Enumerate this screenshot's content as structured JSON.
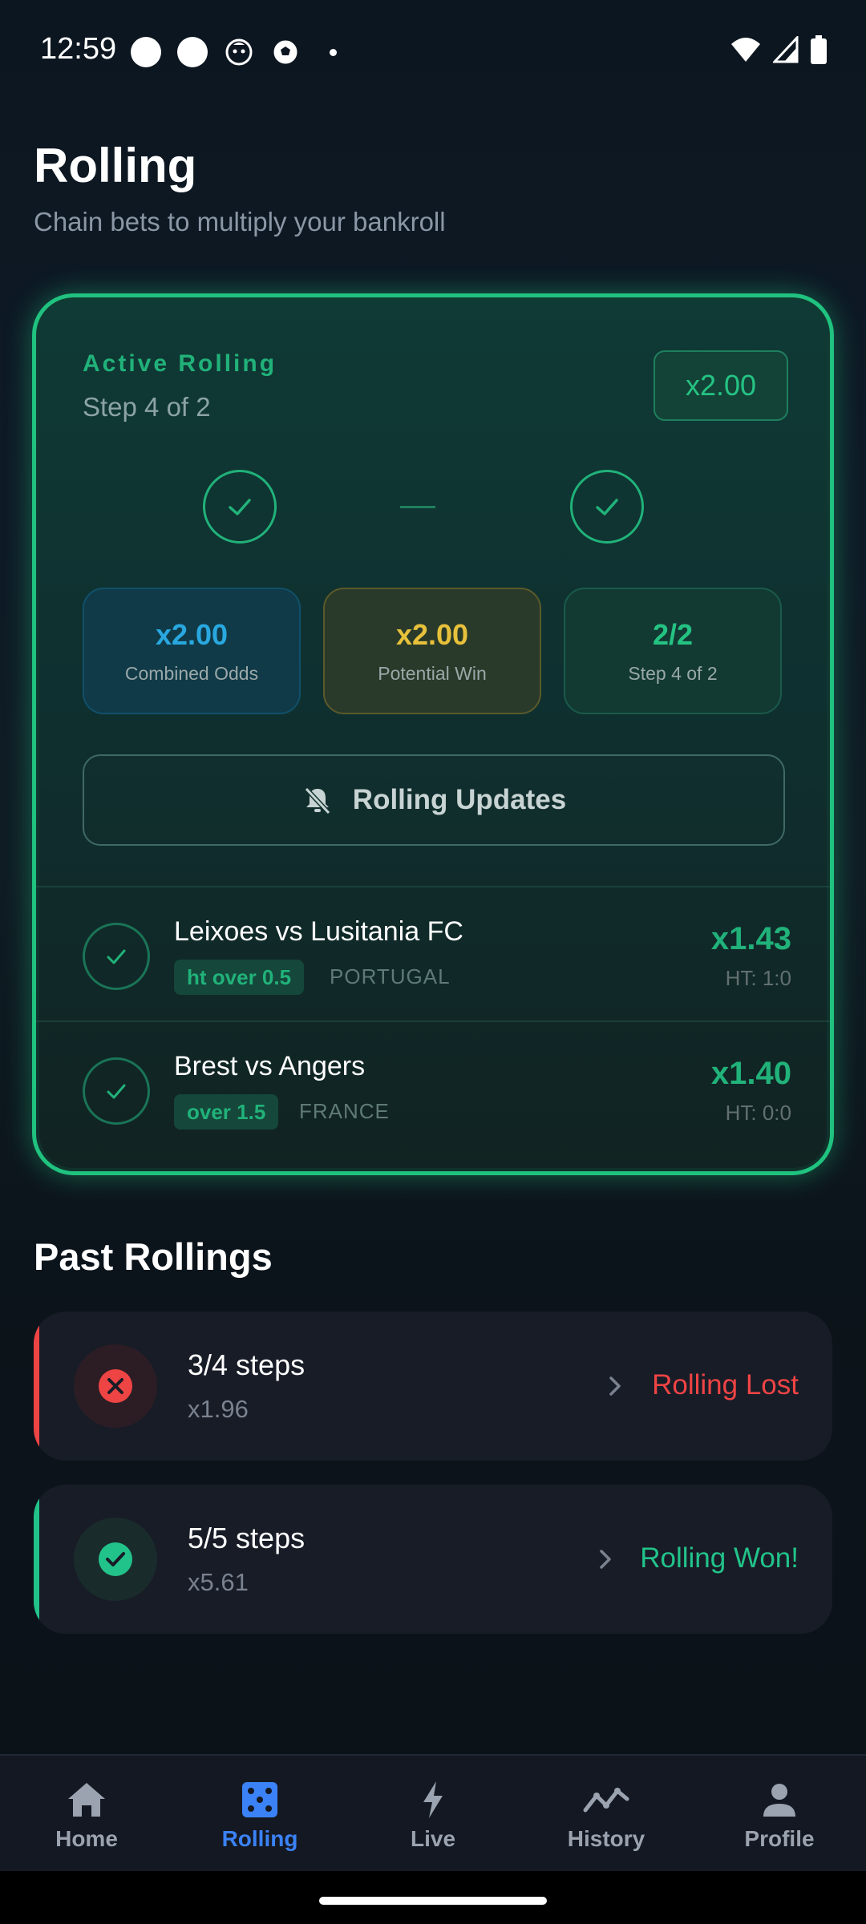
{
  "status_bar": {
    "time": "12:59"
  },
  "header": {
    "title": "Rolling",
    "subtitle": "Chain bets to multiply your bankroll"
  },
  "active": {
    "label": "Active Rolling",
    "step_text": "Step 4 of 2",
    "multiplier": "x2.00",
    "stats": [
      {
        "value": "x2.00",
        "label": "Combined Odds"
      },
      {
        "value": "x2.00",
        "label": "Potential Win"
      },
      {
        "value": "2/2",
        "label": "Step 4 of 2"
      }
    ],
    "updates_label": "Rolling Updates",
    "bets": [
      {
        "match": "Leixoes vs Lusitania FC",
        "market": "ht over 0.5",
        "country": "PORTUGAL",
        "odds": "x1.43",
        "ht": "HT: 1:0"
      },
      {
        "match": "Brest vs Angers",
        "market": "over 1.5",
        "country": "FRANCE",
        "odds": "x1.40",
        "ht": "HT: 0:0"
      }
    ]
  },
  "past": {
    "title": "Past Rollings",
    "items": [
      {
        "steps": "3/4 steps",
        "multiplier": "x1.96",
        "status": "Rolling Lost",
        "color": "#ef4444"
      },
      {
        "steps": "5/5 steps",
        "multiplier": "x5.61",
        "status": "Rolling Won!",
        "color": "#22c38a"
      }
    ]
  },
  "nav": {
    "items": [
      {
        "label": "Home",
        "icon": "home-icon"
      },
      {
        "label": "Rolling",
        "icon": "dice-icon"
      },
      {
        "label": "Live",
        "icon": "bolt-icon"
      },
      {
        "label": "History",
        "icon": "trend-icon"
      },
      {
        "label": "Profile",
        "icon": "person-icon"
      }
    ],
    "active_color": "#3b82f6"
  }
}
